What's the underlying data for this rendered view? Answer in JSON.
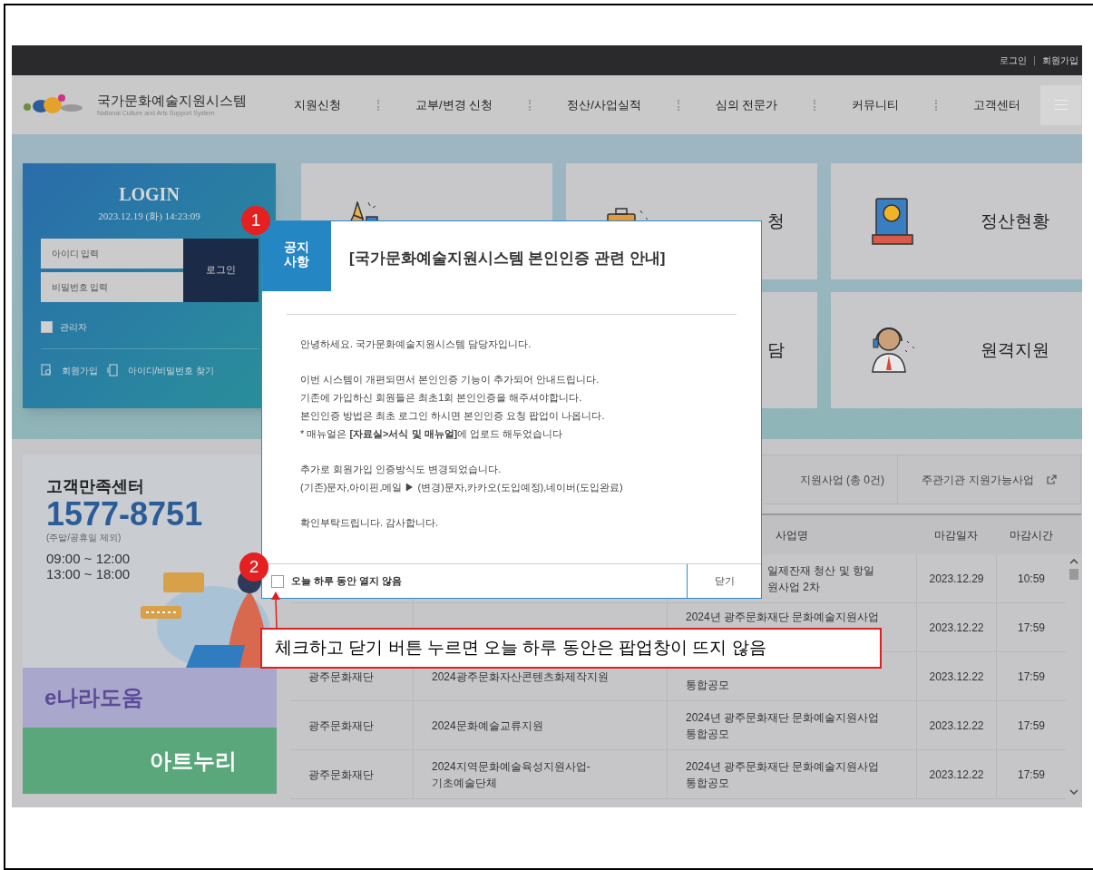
{
  "top_bar": {
    "links": [
      "로그인",
      "회원가입"
    ]
  },
  "header": {
    "logo_title": "국가문화예술지원시스템",
    "logo_subtitle": "National Culture and Arts Support System",
    "nav": [
      "지원신청",
      "교부/변경 신청",
      "정산/사업실적",
      "심의 전문가",
      "커뮤니티",
      "고객센터"
    ]
  },
  "login": {
    "title": "LOGIN",
    "datetime": "2023.12.19 (화) 14:23:09",
    "id_placeholder": "아이디 입력",
    "pw_placeholder": "비밀번호 입력",
    "button": "로그인",
    "admin": {
      "label": "관리자",
      "checked": false
    },
    "links": [
      {
        "label": "회원가입"
      },
      {
        "label": "아이디/비밀번호 찾기"
      }
    ]
  },
  "tiles": [
    {
      "label": "청"
    },
    {
      "label": "정산현황"
    },
    {
      "label": "담"
    },
    {
      "label": "원격지원"
    }
  ],
  "customer_center": {
    "title": "고객만족센터",
    "phone": "1577-8751",
    "note": "(주말/공휴일 제외)",
    "hours": [
      "09:00 ~ 12:00",
      "13:00 ~ 18:00"
    ]
  },
  "banners": [
    {
      "kind": "lavender",
      "text": "e나라도움"
    },
    {
      "kind": "green",
      "text": "아트누리"
    }
  ],
  "tabs": [
    {
      "label": "지원사업 (총 0건)",
      "external": false
    },
    {
      "label": "주관기관 지원가능사업",
      "external": true
    }
  ],
  "table": {
    "columns": [
      {
        "kind": "hidden"
      },
      {
        "kind": "hidden"
      },
      {
        "kind": "text",
        "label": "사업명"
      },
      {
        "kind": "text",
        "label": "마감일자"
      },
      {
        "kind": "text",
        "label": "마감시간"
      }
    ],
    "rows": [
      {
        "cells": [
          {
            "kind": "hidden"
          },
          {
            "kind": "hidden"
          },
          {
            "kind": "text",
            "lines": [
              "일제잔재 청산 및 항일",
              "원사업 2차"
            ]
          },
          {
            "kind": "text",
            "lines": [
              "2023.12.29"
            ]
          },
          {
            "kind": "text",
            "lines": [
              "10:59"
            ]
          }
        ]
      },
      {
        "cells": [
          {
            "kind": "hidden"
          },
          {
            "kind": "hidden"
          },
          {
            "kind": "text",
            "lines": [
              "2024년 광주문화재단 문화예술지원사업"
            ]
          },
          {
            "kind": "text",
            "lines": [
              "2023.12.22"
            ]
          },
          {
            "kind": "text",
            "lines": [
              "17:59"
            ]
          }
        ]
      },
      {
        "cells": [
          {
            "kind": "text",
            "lines": [
              "광주문화재단"
            ]
          },
          {
            "kind": "text",
            "lines": [
              "2024광주문화자산콘텐츠화제작지원"
            ]
          },
          {
            "kind": "text",
            "lines": [
              "통합공모"
            ]
          },
          {
            "kind": "text",
            "lines": [
              "2023.12.22"
            ]
          },
          {
            "kind": "text",
            "lines": [
              "17:59"
            ]
          }
        ]
      },
      {
        "cells": [
          {
            "kind": "text",
            "lines": [
              "광주문화재단"
            ]
          },
          {
            "kind": "text",
            "lines": [
              "2024문화예술교류지원"
            ]
          },
          {
            "kind": "text",
            "lines": [
              "2024년 광주문화재단 문화예술지원사업",
              "통합공모"
            ]
          },
          {
            "kind": "text",
            "lines": [
              "2023.12.22"
            ]
          },
          {
            "kind": "text",
            "lines": [
              "17:59"
            ]
          }
        ]
      },
      {
        "cells": [
          {
            "kind": "text",
            "lines": [
              "광주문화재단"
            ]
          },
          {
            "kind": "text",
            "lines": [
              "2024지역문화예술육성지원사업-",
              "기초예술단체"
            ]
          },
          {
            "kind": "text",
            "lines": [
              "2024년 광주문화재단 문화예술지원사업",
              "통합공모"
            ]
          },
          {
            "kind": "text",
            "lines": [
              "2023.12.22"
            ]
          },
          {
            "kind": "text",
            "lines": [
              "17:59"
            ]
          }
        ]
      }
    ]
  },
  "popup": {
    "tag": "공지 사항",
    "title": "[국가문화예술지원시스템 본인인증 관련 안내]",
    "paragraphs": [
      [
        "안녕하세요. 국가문화예술지원시스템 담당자입니다."
      ],
      [
        "이번 시스템이 개편되면서 본인인증 기능이 추가되어 안내드립니다.",
        "기존에 가입하신 회원들은 최초1회 본인인증을 해주셔야합니다.",
        "본인인증 방법은 최초 로그인 하시면 본인인증 요청 팝업이 나옵니다.",
        "* 매뉴얼은 **[자료실>서식 및 매뉴얼]**에 업로드 해두었습니다"
      ],
      [
        "추가로 회원가입 인증방식도 변경되었습니다.",
        "(기존)문자,아이핀,메일 ▶ (변경)문자,카카오(도입예정),네이버(도입완료)"
      ],
      [
        "확인부탁드립니다. 감사합니다."
      ]
    ],
    "dont_show": {
      "label": "오늘 하루 동안 열지 않음",
      "checked": false
    },
    "close": "닫기"
  },
  "annotations": [
    {
      "number": "1"
    },
    {
      "number": "2"
    }
  ],
  "callout": "체크하고 닫기 버튼 누르면 오늘 하루 동안은 팝업창이 뜨지 않음"
}
